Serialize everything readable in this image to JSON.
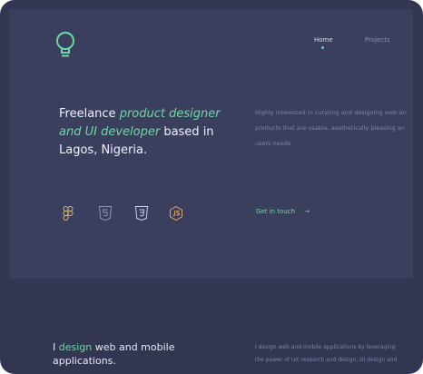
{
  "nav": {
    "items": [
      {
        "label": "Home",
        "active": true
      },
      {
        "label": "Projects",
        "active": false
      }
    ]
  },
  "hero": {
    "headline": {
      "prefix": "Freelance ",
      "highlight": "product designer and UI developer",
      "suffix": " based in Lagos, Nigeria."
    },
    "intro_lines": [
      "Highly interested in curating and designing web an",
      "products that are usable, aesthetically pleasing an",
      "users needs."
    ],
    "tech_icons": [
      "figma-icon",
      "html5-icon",
      "css3-icon",
      "nodejs-icon"
    ],
    "cta_label": "Get in touch",
    "cta_arrow": "→"
  },
  "section2": {
    "title_prefix": "I ",
    "title_highlight": "design",
    "title_suffix": " web and mobile applications.",
    "text_lines": [
      "I design web and mobile applications by leveraging",
      "the power of UX research and design, UI design and"
    ]
  },
  "colors": {
    "background": "#333650",
    "hero_panel": "#3b3f5e",
    "accent": "#6fd6a5",
    "muted_text": "#7f84a7"
  }
}
